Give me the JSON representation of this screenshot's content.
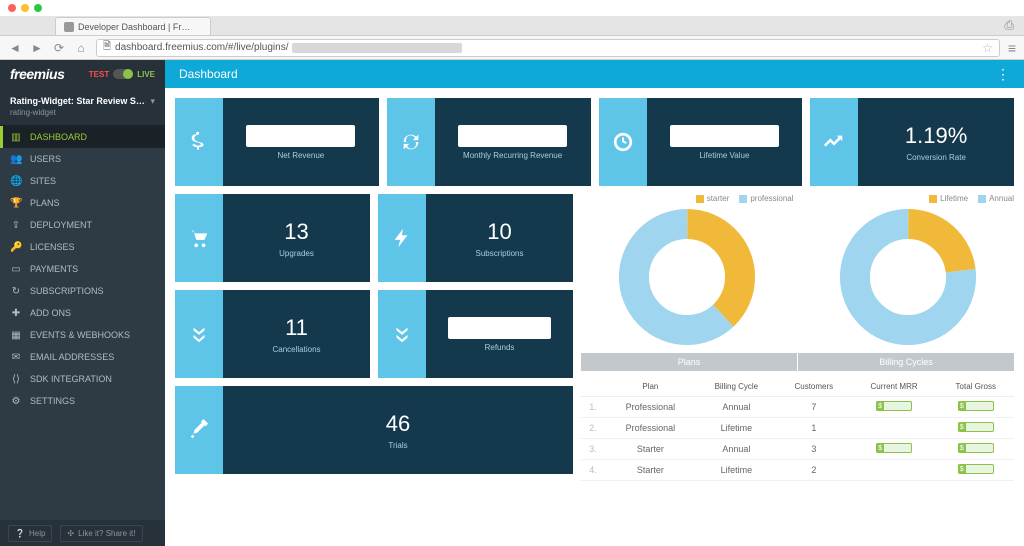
{
  "browser": {
    "tab_title": "Developer Dashboard | Fr…",
    "url_visible": "dashboard.freemius.com/#/live/plugins/"
  },
  "sidebar": {
    "logo": "freemius",
    "toggle": {
      "test": "TEST",
      "live": "LIVE"
    },
    "product": {
      "title": "Rating-Widget: Star Review S…",
      "sub": "rating-widget"
    },
    "items": [
      {
        "label": "DASHBOARD",
        "icon": "chart-bars-icon"
      },
      {
        "label": "USERS",
        "icon": "users-icon"
      },
      {
        "label": "SITES",
        "icon": "globe-icon"
      },
      {
        "label": "PLANS",
        "icon": "trophy-icon"
      },
      {
        "label": "DEPLOYMENT",
        "icon": "upload-icon"
      },
      {
        "label": "LICENSES",
        "icon": "key-icon"
      },
      {
        "label": "PAYMENTS",
        "icon": "card-icon"
      },
      {
        "label": "SUBSCRIPTIONS",
        "icon": "refresh-icon"
      },
      {
        "label": "ADD ONS",
        "icon": "puzzle-icon"
      },
      {
        "label": "EVENTS & WEBHOOKS",
        "icon": "calendar-icon"
      },
      {
        "label": "EMAIL ADDRESSES",
        "icon": "envelope-icon"
      },
      {
        "label": "SDK INTEGRATION",
        "icon": "code-icon"
      },
      {
        "label": "SETTINGS",
        "icon": "gear-icon"
      }
    ],
    "footer": {
      "help": "Help",
      "share": "Like it? Share it!"
    }
  },
  "topbar": {
    "title": "Dashboard"
  },
  "kpis": {
    "net_revenue": {
      "label": "Net Revenue"
    },
    "mrr": {
      "label": "Monthly Recurring Revenue"
    },
    "ltv": {
      "label": "Lifetime Value"
    },
    "conversion": {
      "value": "1.19%",
      "label": "Conversion Rate"
    }
  },
  "mini": {
    "upgrades": {
      "value": "13",
      "label": "Upgrades"
    },
    "subscriptions": {
      "value": "10",
      "label": "Subscriptions"
    },
    "cancellations": {
      "value": "11",
      "label": "Cancellations"
    },
    "refunds": {
      "label": "Refunds"
    },
    "trials": {
      "value": "46",
      "label": "Trials"
    }
  },
  "legend1": {
    "a": "starter",
    "b": "professional"
  },
  "legend2": {
    "a": "Lifetime",
    "b": "Annual"
  },
  "tables_header": {
    "plans": "Plans",
    "billing": "Billing Cycles"
  },
  "table": {
    "cols": {
      "plan": "Plan",
      "cycle": "Billing Cycle",
      "customers": "Customers",
      "mrr": "Current MRR",
      "gross": "Total Gross"
    },
    "rows": [
      {
        "idx": "1.",
        "plan": "Professional",
        "cycle": "Annual",
        "customers": "7"
      },
      {
        "idx": "2.",
        "plan": "Professional",
        "cycle": "Lifetime",
        "customers": "1"
      },
      {
        "idx": "3.",
        "plan": "Starter",
        "cycle": "Annual",
        "customers": "3"
      },
      {
        "idx": "4.",
        "plan": "Starter",
        "cycle": "Lifetime",
        "customers": "2"
      }
    ]
  },
  "colors": {
    "yellow": "#f0b93a",
    "blue": "#9fd5ee"
  },
  "chart_data": [
    {
      "type": "pie",
      "title": "Plans",
      "series": [
        {
          "name": "starter",
          "value": 38,
          "color": "#f0b93a"
        },
        {
          "name": "professional",
          "value": 62,
          "color": "#9fd5ee"
        }
      ]
    },
    {
      "type": "pie",
      "title": "Billing Cycles",
      "series": [
        {
          "name": "Lifetime",
          "value": 23,
          "color": "#f0b93a"
        },
        {
          "name": "Annual",
          "value": 77,
          "color": "#9fd5ee"
        }
      ]
    }
  ]
}
